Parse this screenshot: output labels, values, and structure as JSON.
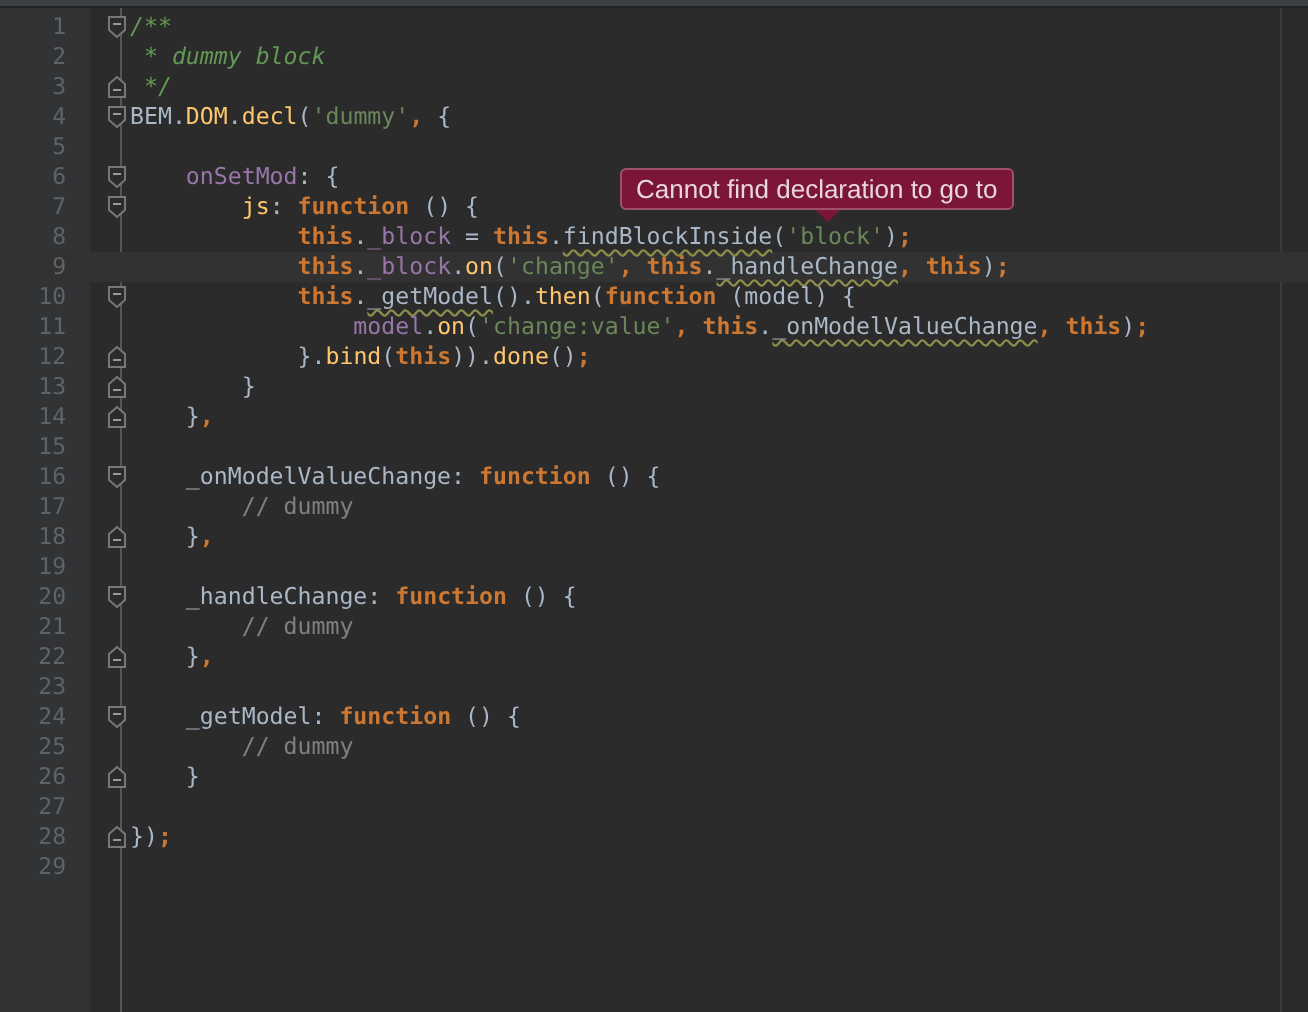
{
  "editor": {
    "lines": [
      {
        "number": "1",
        "kind": "opener",
        "current": false,
        "tokens": [
          {
            "t": "/**",
            "kind": "doc"
          }
        ]
      },
      {
        "number": "2",
        "kind": "plain",
        "current": false,
        "tokens": [
          {
            "t": " * dummy block",
            "kind": "doc"
          }
        ]
      },
      {
        "number": "3",
        "kind": "closer",
        "current": false,
        "tokens": [
          {
            "t": " */",
            "kind": "doc"
          }
        ]
      },
      {
        "number": "4",
        "kind": "opener",
        "current": false,
        "tokens": [
          {
            "t": "BEM.",
            "kind": "plain"
          },
          {
            "t": "DOM",
            "kind": "method"
          },
          {
            "t": ".",
            "kind": "plain"
          },
          {
            "t": "decl",
            "kind": "method"
          },
          {
            "t": "(",
            "kind": "plain"
          },
          {
            "t": "'dummy'",
            "kind": "string"
          },
          {
            "t": ",",
            "kind": "keyword"
          },
          {
            "t": " {",
            "kind": "plain"
          }
        ]
      },
      {
        "number": "5",
        "kind": "plain",
        "current": false
      },
      {
        "number": "6",
        "kind": "opener",
        "current": false,
        "tokens": [
          {
            "t": "    onSetMod",
            "kind": "field"
          },
          {
            "t": ": {",
            "kind": "plain"
          }
        ]
      },
      {
        "number": "7",
        "kind": "opener",
        "current": false,
        "tokens": [
          {
            "t": "        js",
            "kind": "method"
          },
          {
            "t": ": ",
            "kind": "plain"
          },
          {
            "t": "function",
            "kind": "keyword"
          },
          {
            "t": " () {",
            "kind": "plain"
          }
        ]
      },
      {
        "number": "8",
        "kind": "plain",
        "current": false,
        "tokens": [
          {
            "t": "            this",
            "kind": "keyword"
          },
          {
            "t": ".",
            "kind": "plain"
          },
          {
            "t": "_block",
            "kind": "field"
          },
          {
            "t": " = ",
            "kind": "plain"
          },
          {
            "t": "this",
            "kind": "keyword"
          },
          {
            "t": ".",
            "kind": "plain"
          },
          {
            "t": "findBlockInside",
            "kind": "plain",
            "warn": true
          },
          {
            "t": "(",
            "kind": "plain"
          },
          {
            "t": "'block'",
            "kind": "string"
          },
          {
            "t": ")",
            "kind": "plain"
          },
          {
            "t": ";",
            "kind": "keyword"
          }
        ]
      },
      {
        "number": "9",
        "kind": "plain",
        "current": true,
        "tokens": [
          {
            "t": "            this",
            "kind": "keyword"
          },
          {
            "t": ".",
            "kind": "plain"
          },
          {
            "t": "_block",
            "kind": "field"
          },
          {
            "t": ".",
            "kind": "plain"
          },
          {
            "t": "on",
            "kind": "method"
          },
          {
            "t": "(",
            "kind": "plain"
          },
          {
            "t": "'change'",
            "kind": "string"
          },
          {
            "t": ",",
            "kind": "keyword"
          },
          {
            "t": " this",
            "kind": "keyword"
          },
          {
            "t": ".",
            "kind": "plain"
          },
          {
            "t": "_handleChange",
            "kind": "plain",
            "warn": true
          },
          {
            "t": ",",
            "kind": "keyword"
          },
          {
            "t": " this",
            "kind": "keyword"
          },
          {
            "t": ")",
            "kind": "plain"
          },
          {
            "t": ";",
            "kind": "keyword"
          }
        ]
      },
      {
        "number": "10",
        "kind": "opener",
        "current": false,
        "tokens": [
          {
            "t": "            this",
            "kind": "keyword"
          },
          {
            "t": ".",
            "kind": "plain"
          },
          {
            "t": "_getModel",
            "kind": "plain",
            "warn": true
          },
          {
            "t": "().",
            "kind": "plain"
          },
          {
            "t": "then",
            "kind": "method"
          },
          {
            "t": "(",
            "kind": "plain"
          },
          {
            "t": "function",
            "kind": "keyword"
          },
          {
            "t": " (model) {",
            "kind": "plain"
          }
        ]
      },
      {
        "number": "11",
        "kind": "plain",
        "current": false,
        "tokens": [
          {
            "t": "                model",
            "kind": "field"
          },
          {
            "t": ".",
            "kind": "plain"
          },
          {
            "t": "on",
            "kind": "method"
          },
          {
            "t": "(",
            "kind": "plain"
          },
          {
            "t": "'change:value'",
            "kind": "string"
          },
          {
            "t": ",",
            "kind": "keyword"
          },
          {
            "t": " this",
            "kind": "keyword"
          },
          {
            "t": ".",
            "kind": "plain"
          },
          {
            "t": "_onModelValueChange",
            "kind": "plain",
            "warn": true
          },
          {
            "t": ",",
            "kind": "keyword"
          },
          {
            "t": " this",
            "kind": "keyword"
          },
          {
            "t": ")",
            "kind": "plain"
          },
          {
            "t": ";",
            "kind": "keyword"
          }
        ]
      },
      {
        "number": "12",
        "kind": "closer",
        "current": false,
        "tokens": [
          {
            "t": "            }.",
            "kind": "plain"
          },
          {
            "t": "bind",
            "kind": "method"
          },
          {
            "t": "(",
            "kind": "plain"
          },
          {
            "t": "this",
            "kind": "keyword"
          },
          {
            "t": ")).",
            "kind": "plain"
          },
          {
            "t": "done",
            "kind": "method"
          },
          {
            "t": "()",
            "kind": "plain"
          },
          {
            "t": ";",
            "kind": "keyword"
          }
        ]
      },
      {
        "number": "13",
        "kind": "closer",
        "current": false,
        "tokens": [
          {
            "t": "        }",
            "kind": "plain"
          }
        ]
      },
      {
        "number": "14",
        "kind": "closer",
        "current": false,
        "tokens": [
          {
            "t": "    }",
            "kind": "plain"
          },
          {
            "t": ",",
            "kind": "keyword"
          }
        ]
      },
      {
        "number": "15",
        "kind": "plain",
        "current": false
      },
      {
        "number": "16",
        "kind": "opener",
        "current": false,
        "tokens": [
          {
            "t": "    _onModelValueChange: ",
            "kind": "plain"
          },
          {
            "t": "function",
            "kind": "keyword"
          },
          {
            "t": " () {",
            "kind": "plain"
          }
        ]
      },
      {
        "number": "17",
        "kind": "plain",
        "current": false,
        "tokens": [
          {
            "t": "        // dummy",
            "kind": "comment"
          }
        ]
      },
      {
        "number": "18",
        "kind": "closer",
        "current": false,
        "tokens": [
          {
            "t": "    }",
            "kind": "plain"
          },
          {
            "t": ",",
            "kind": "keyword"
          }
        ]
      },
      {
        "number": "19",
        "kind": "plain",
        "current": false
      },
      {
        "number": "20",
        "kind": "opener",
        "current": false,
        "tokens": [
          {
            "t": "    _handleChange: ",
            "kind": "plain"
          },
          {
            "t": "function",
            "kind": "keyword"
          },
          {
            "t": " () {",
            "kind": "plain"
          }
        ]
      },
      {
        "number": "21",
        "kind": "plain",
        "current": false,
        "tokens": [
          {
            "t": "        // dummy",
            "kind": "comment"
          }
        ]
      },
      {
        "number": "22",
        "kind": "closer",
        "current": false,
        "tokens": [
          {
            "t": "    }",
            "kind": "plain"
          },
          {
            "t": ",",
            "kind": "keyword"
          }
        ]
      },
      {
        "number": "23",
        "kind": "plain",
        "current": false
      },
      {
        "number": "24",
        "kind": "opener",
        "current": false,
        "tokens": [
          {
            "t": "    _getModel: ",
            "kind": "plain"
          },
          {
            "t": "function",
            "kind": "keyword"
          },
          {
            "t": " () {",
            "kind": "plain"
          }
        ]
      },
      {
        "number": "25",
        "kind": "plain",
        "current": false,
        "tokens": [
          {
            "t": "        // dummy",
            "kind": "comment"
          }
        ]
      },
      {
        "number": "26",
        "kind": "closer",
        "current": false,
        "tokens": [
          {
            "t": "    }",
            "kind": "plain"
          }
        ]
      },
      {
        "number": "27",
        "kind": "plain",
        "current": false
      },
      {
        "number": "28",
        "kind": "closer",
        "current": false,
        "tokens": [
          {
            "t": "})",
            "kind": "plain"
          },
          {
            "t": ";",
            "kind": "keyword"
          }
        ]
      },
      {
        "number": "29",
        "kind": "plain",
        "current": false
      }
    ]
  },
  "tooltip": {
    "text": "Cannot find declaration to go to"
  }
}
